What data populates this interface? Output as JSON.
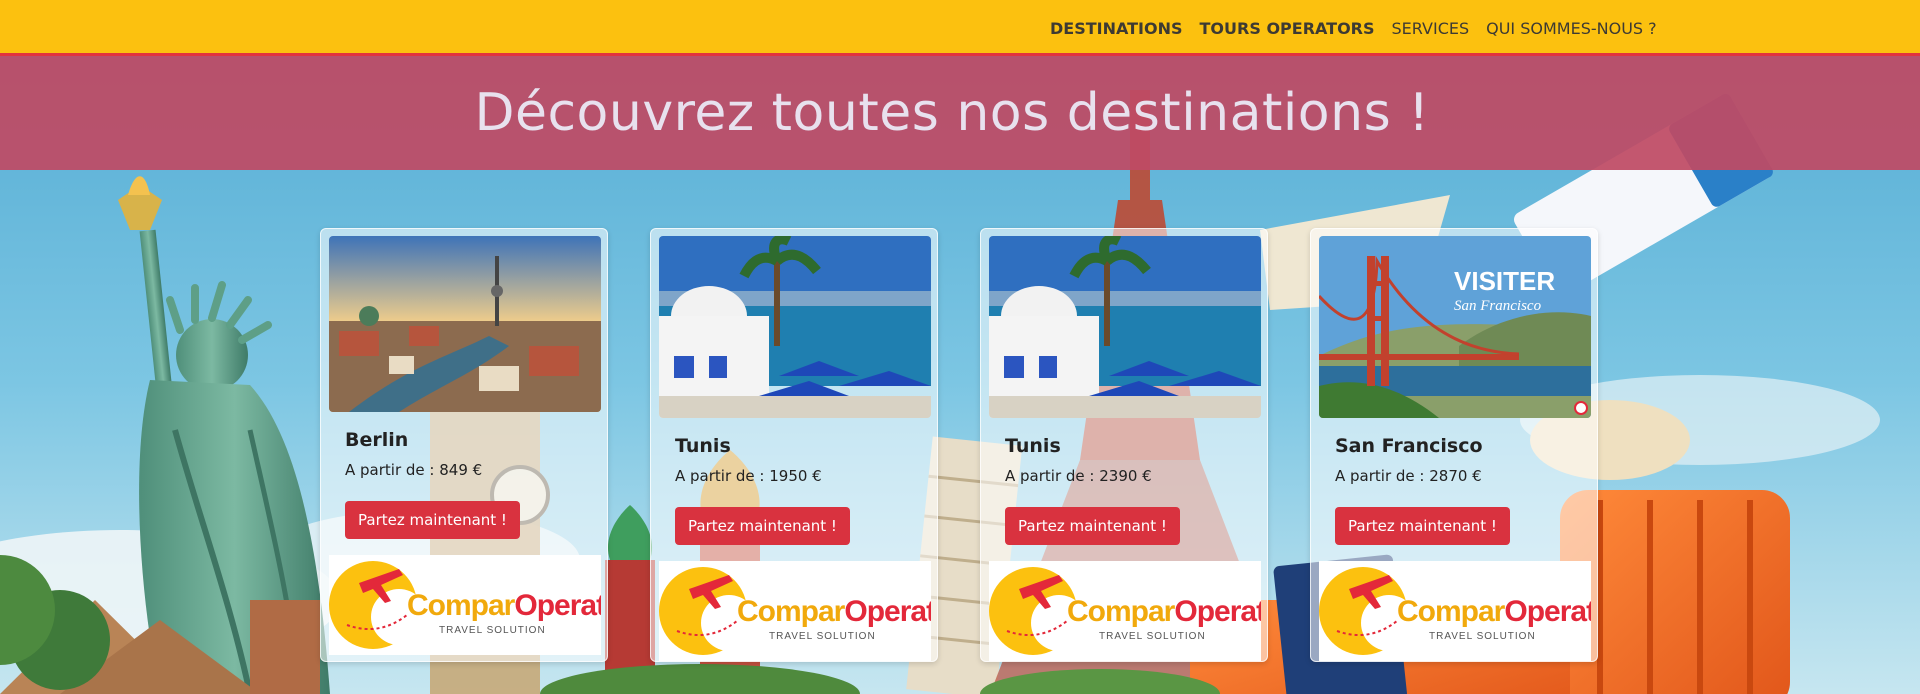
{
  "nav": {
    "items": [
      {
        "label": "DESTINATIONS",
        "bold": true
      },
      {
        "label": "TOURS OPERATORS",
        "bold": true
      },
      {
        "label": "SERVICES",
        "bold": false
      },
      {
        "label": "QUI SOMMES-NOUS ?",
        "bold": false
      }
    ]
  },
  "banner": {
    "title": "Découvrez toutes nos destinations !"
  },
  "cards": [
    {
      "name": "Berlin",
      "price": "A partir de : 849 €",
      "button": "Partez maintenant !",
      "photo": "berlin-cityscape"
    },
    {
      "name": "Tunis",
      "price": "A partir de : 1950 €",
      "button": "Partez maintenant !",
      "photo": "tunis-harbor"
    },
    {
      "name": "Tunis",
      "price": "A partir de : 2390 €",
      "button": "Partez maintenant !",
      "photo": "tunis-harbor"
    },
    {
      "name": "San Francisco",
      "price": "A partir de : 2870 €",
      "button": "Partez maintenant !",
      "photo": "golden-gate-bridge",
      "photo_caption": {
        "line1": "VISITER",
        "line2": "San Francisco"
      }
    }
  ],
  "logo": {
    "word_a": "Compar",
    "word_b": "Operator",
    "tagline": "TRAVEL SOLUTION"
  },
  "colors": {
    "topbar": "#fcc10f",
    "banner": "#be4a64",
    "button": "#d9323f",
    "accent_red": "#e2333d"
  }
}
